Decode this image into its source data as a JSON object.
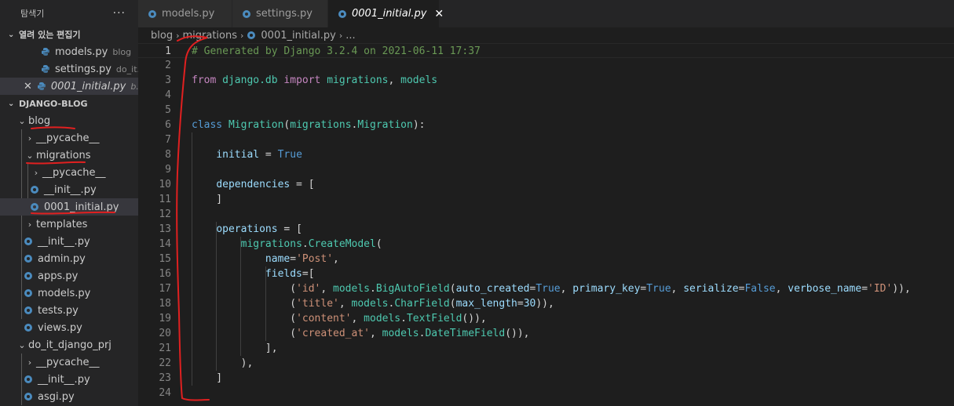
{
  "explorer": {
    "title": "탐색기",
    "more": "···",
    "open_editors": {
      "title": "열려 있는 편집기",
      "items": [
        {
          "name": "models.py",
          "desc": "blog"
        },
        {
          "name": "settings.py",
          "desc": "do_it..."
        },
        {
          "name": "0001_initial.py",
          "desc": "b..."
        }
      ]
    },
    "project": {
      "title": "DJANGO-BLOG",
      "tree": {
        "blog": "blog",
        "pycache1": "__pycache__",
        "migrations": "migrations",
        "pycache2": "__pycache__",
        "init1": "__init__.py",
        "initial": "0001_initial.py",
        "templates": "templates",
        "init2": "__init__.py",
        "admin": "admin.py",
        "apps": "apps.py",
        "models": "models.py",
        "tests": "tests.py",
        "views": "views.py",
        "prj": "do_it_django_prj",
        "pycache3": "__pycache__",
        "init3": "__init__.py",
        "asgi": "asgi.py"
      }
    }
  },
  "tabs": [
    {
      "label": "models.py"
    },
    {
      "label": "settings.py"
    },
    {
      "label": "0001_initial.py"
    }
  ],
  "tab_close": "✕",
  "breadcrumb": {
    "p1": "blog",
    "p2": "migrations",
    "p3": "0001_initial.py",
    "p4": "..."
  },
  "editor": {
    "lines": [
      [
        {
          "t": "# Generated by Django 3.2.4 on 2021-06-11 17:37",
          "c": "cm"
        }
      ],
      [],
      [
        {
          "t": "from ",
          "c": "kw"
        },
        {
          "t": "django.db ",
          "c": "cls"
        },
        {
          "t": "import ",
          "c": "kw"
        },
        {
          "t": "migrations",
          "c": "cls"
        },
        {
          "t": ", ",
          "c": ""
        },
        {
          "t": "models",
          "c": "cls"
        }
      ],
      [],
      [],
      [
        {
          "t": "class ",
          "c": "kb"
        },
        {
          "t": "Migration",
          "c": "cls"
        },
        {
          "t": "(",
          "c": ""
        },
        {
          "t": "migrations",
          "c": "cls"
        },
        {
          "t": ".",
          "c": ""
        },
        {
          "t": "Migration",
          "c": "cls"
        },
        {
          "t": "):",
          "c": ""
        }
      ],
      [],
      [
        {
          "t": "    ",
          "c": ""
        },
        {
          "t": "initial",
          "c": "vr"
        },
        {
          "t": " = ",
          "c": ""
        },
        {
          "t": "True",
          "c": "kb"
        }
      ],
      [],
      [
        {
          "t": "    ",
          "c": ""
        },
        {
          "t": "dependencies",
          "c": "vr"
        },
        {
          "t": " = [",
          "c": ""
        }
      ],
      [
        {
          "t": "    ]",
          "c": ""
        }
      ],
      [],
      [
        {
          "t": "    ",
          "c": ""
        },
        {
          "t": "operations",
          "c": "vr"
        },
        {
          "t": " = [",
          "c": ""
        }
      ],
      [
        {
          "t": "        ",
          "c": ""
        },
        {
          "t": "migrations",
          "c": "cls"
        },
        {
          "t": ".",
          "c": ""
        },
        {
          "t": "CreateModel",
          "c": "cls"
        },
        {
          "t": "(",
          "c": ""
        }
      ],
      [
        {
          "t": "            ",
          "c": ""
        },
        {
          "t": "name",
          "c": "vr"
        },
        {
          "t": "=",
          "c": ""
        },
        {
          "t": "'Post'",
          "c": "st"
        },
        {
          "t": ",",
          "c": ""
        }
      ],
      [
        {
          "t": "            ",
          "c": ""
        },
        {
          "t": "fields",
          "c": "vr"
        },
        {
          "t": "=[",
          "c": ""
        }
      ],
      [
        {
          "t": "                (",
          "c": ""
        },
        {
          "t": "'id'",
          "c": "st"
        },
        {
          "t": ", ",
          "c": ""
        },
        {
          "t": "models",
          "c": "cls"
        },
        {
          "t": ".",
          "c": ""
        },
        {
          "t": "BigAutoField",
          "c": "cls"
        },
        {
          "t": "(",
          "c": ""
        },
        {
          "t": "auto_created",
          "c": "vr"
        },
        {
          "t": "=",
          "c": ""
        },
        {
          "t": "True",
          "c": "kb"
        },
        {
          "t": ", ",
          "c": ""
        },
        {
          "t": "primary_key",
          "c": "vr"
        },
        {
          "t": "=",
          "c": ""
        },
        {
          "t": "True",
          "c": "kb"
        },
        {
          "t": ", ",
          "c": ""
        },
        {
          "t": "serialize",
          "c": "vr"
        },
        {
          "t": "=",
          "c": ""
        },
        {
          "t": "False",
          "c": "kb"
        },
        {
          "t": ", ",
          "c": ""
        },
        {
          "t": "verbose_name",
          "c": "vr"
        },
        {
          "t": "=",
          "c": ""
        },
        {
          "t": "'ID'",
          "c": "st"
        },
        {
          "t": ")),",
          "c": ""
        }
      ],
      [
        {
          "t": "                (",
          "c": ""
        },
        {
          "t": "'title'",
          "c": "st"
        },
        {
          "t": ", ",
          "c": ""
        },
        {
          "t": "models",
          "c": "cls"
        },
        {
          "t": ".",
          "c": ""
        },
        {
          "t": "CharField",
          "c": "cls"
        },
        {
          "t": "(",
          "c": ""
        },
        {
          "t": "max_length",
          "c": "vr"
        },
        {
          "t": "=",
          "c": ""
        },
        {
          "t": "30",
          "c": "nm"
        },
        {
          "t": ")),",
          "c": ""
        }
      ],
      [
        {
          "t": "                (",
          "c": ""
        },
        {
          "t": "'content'",
          "c": "st"
        },
        {
          "t": ", ",
          "c": ""
        },
        {
          "t": "models",
          "c": "cls"
        },
        {
          "t": ".",
          "c": ""
        },
        {
          "t": "TextField",
          "c": "cls"
        },
        {
          "t": "()),",
          "c": ""
        }
      ],
      [
        {
          "t": "                (",
          "c": ""
        },
        {
          "t": "'created_at'",
          "c": "st"
        },
        {
          "t": ", ",
          "c": ""
        },
        {
          "t": "models",
          "c": "cls"
        },
        {
          "t": ".",
          "c": ""
        },
        {
          "t": "DateTimeField",
          "c": "cls"
        },
        {
          "t": "()),",
          "c": ""
        }
      ],
      [
        {
          "t": "            ],",
          "c": ""
        }
      ],
      [
        {
          "t": "        ),",
          "c": ""
        }
      ],
      [
        {
          "t": "    ]",
          "c": ""
        }
      ],
      []
    ]
  },
  "colors": {
    "accent_python": "#4b8bbe",
    "annotation": "#e02020"
  }
}
